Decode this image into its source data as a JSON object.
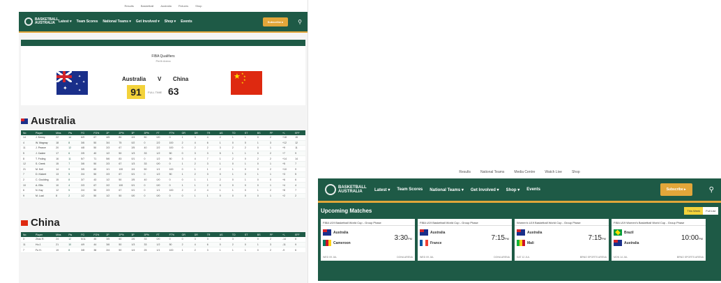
{
  "left": {
    "top_links": [
      "Results",
      "Basketball",
      "Australia",
      "Fixtures",
      "Shop"
    ],
    "nav": {
      "logo_text": "BASKETBALL AUSTRALIA",
      "items": [
        "Latest ▾",
        "Team Scores",
        "National Teams ▾",
        "Get Involved ▾",
        "Shop ▾",
        "Events"
      ],
      "button": "Subscribe ▸"
    },
    "match": {
      "venue": "FIBA Qualifiers",
      "venue_sub": "Perth Arena",
      "home_team": "Australia",
      "vs": "V",
      "away_team": "China",
      "home_score": "91",
      "status": "FULL TIME",
      "away_score": "63"
    },
    "australia_title": "Australia",
    "china_title": "China",
    "table_headers": [
      "No",
      "Player",
      "Mins",
      "Pts",
      "FG",
      "FG%",
      "2P",
      "2P%",
      "3P",
      "3P%",
      "FT",
      "FT%",
      "OR",
      "DR",
      "TR",
      "AS",
      "TO",
      "ST",
      "BS",
      "PF",
      "+/-",
      "EFF"
    ],
    "australia_rows": [
      [
        "14",
        "J. Kenny",
        "22",
        "14",
        "6/9",
        "67",
        "4/5",
        "80",
        "2/4",
        "50",
        "0/0",
        "0",
        "1",
        "3",
        "4",
        "2",
        "1",
        "1",
        "0",
        "2",
        "+18",
        "15"
      ],
      [
        "4",
        "W. Magnay",
        "18",
        "8",
        "3/6",
        "50",
        "3/4",
        "75",
        "0/2",
        "0",
        "2/2",
        "100",
        "2",
        "4",
        "6",
        "1",
        "0",
        "0",
        "1",
        "3",
        "+12",
        "12"
      ],
      [
        "11",
        "J. Pearce",
        "20",
        "12",
        "4/8",
        "50",
        "2/3",
        "67",
        "2/5",
        "40",
        "2/2",
        "100",
        "0",
        "2",
        "2",
        "3",
        "2",
        "2",
        "0",
        "1",
        "+9",
        "11"
      ],
      [
        "5",
        "J. Cadee",
        "17",
        "6",
        "2/5",
        "40",
        "1/2",
        "50",
        "1/3",
        "33",
        "1/2",
        "50",
        "0",
        "3",
        "3",
        "5",
        "1",
        "1",
        "0",
        "2",
        "+7",
        "9"
      ],
      [
        "8",
        "T. Froling",
        "16",
        "11",
        "5/7",
        "71",
        "5/6",
        "83",
        "0/1",
        "0",
        "1/2",
        "50",
        "3",
        "4",
        "7",
        "1",
        "2",
        "0",
        "2",
        "2",
        "+14",
        "14"
      ],
      [
        "12",
        "S. Creek",
        "15",
        "7",
        "3/6",
        "50",
        "2/3",
        "67",
        "1/3",
        "33",
        "0/0",
        "0",
        "1",
        "2",
        "3",
        "1",
        "0",
        "1",
        "0",
        "1",
        "+5",
        "7"
      ],
      [
        "21",
        "M. Kell",
        "14",
        "9",
        "3/5",
        "60",
        "1/1",
        "100",
        "2/4",
        "50",
        "1/1",
        "100",
        "0",
        "1",
        "1",
        "2",
        "1",
        "0",
        "0",
        "2",
        "+10",
        "9"
      ],
      [
        "7",
        "D. Kickert",
        "13",
        "5",
        "2/4",
        "50",
        "2/3",
        "67",
        "0/1",
        "0",
        "1/2",
        "50",
        "1",
        "2",
        "3",
        "0",
        "1",
        "0",
        "1",
        "1",
        "+3",
        "5"
      ],
      [
        "2",
        "C. Goulding",
        "15",
        "8",
        "3/7",
        "43",
        "1/2",
        "50",
        "2/5",
        "40",
        "0/0",
        "0",
        "0",
        "1",
        "1",
        "2",
        "0",
        "1",
        "0",
        "0",
        "+6",
        "6"
      ],
      [
        "10",
        "A. Ellis",
        "10",
        "4",
        "2/3",
        "67",
        "2/2",
        "100",
        "0/1",
        "0",
        "0/0",
        "0",
        "1",
        "1",
        "2",
        "0",
        "0",
        "0",
        "0",
        "1",
        "+4",
        "4"
      ],
      [
        "6",
        "N. Kay",
        "12",
        "5",
        "2/4",
        "50",
        "2/3",
        "67",
        "0/1",
        "0",
        "1/1",
        "100",
        "2",
        "2",
        "4",
        "1",
        "1",
        "0",
        "1",
        "2",
        "+8",
        "7"
      ],
      [
        "9",
        "M. Lual",
        "8",
        "2",
        "1/2",
        "50",
        "1/2",
        "50",
        "0/0",
        "0",
        "0/0",
        "0",
        "0",
        "1",
        "1",
        "0",
        "0",
        "0",
        "0",
        "1",
        "+2",
        "2"
      ]
    ],
    "china_rows": [
      [
        "3",
        "Zhao R.",
        "24",
        "12",
        "5/11",
        "45",
        "3/5",
        "60",
        "2/6",
        "33",
        "0/0",
        "0",
        "0",
        "3",
        "3",
        "4",
        "3",
        "1",
        "0",
        "2",
        "-14",
        "8"
      ],
      [
        "11",
        "Hu J.",
        "21",
        "10",
        "4/9",
        "44",
        "3/6",
        "50",
        "1/3",
        "33",
        "1/2",
        "50",
        "2",
        "4",
        "6",
        "0",
        "2",
        "0",
        "1",
        "3",
        "-11",
        "9"
      ],
      [
        "7",
        "Fu H.",
        "19",
        "8",
        "3/8",
        "38",
        "2/4",
        "50",
        "1/4",
        "25",
        "1/1",
        "100",
        "1",
        "2",
        "3",
        "1",
        "1",
        "1",
        "0",
        "2",
        "-9",
        "6"
      ]
    ]
  },
  "right": {
    "top_links": [
      "Results",
      "National Teams",
      "Media Centre",
      "Watch Live",
      "Shop"
    ],
    "nav": {
      "logo_text": "BASKETBALL AUSTRALIA",
      "items": [
        "Latest ▾",
        "Team Scores",
        "National Teams ▾",
        "Get Involved ▾",
        "Shop ▾",
        "Events"
      ],
      "button": "Subscribe ▸"
    },
    "section_title": "Upcoming Matches",
    "toggle": [
      "This Week",
      "Full List"
    ],
    "cards": [
      {
        "title": "FIBA U19 Basketball World Cup - Group Phase",
        "team1": "Australia",
        "team2": "Cameroon",
        "time": "3:30",
        "ampm": "PM",
        "foot_left": "WED 09 JUL",
        "foot_right": "DOHA ARENA"
      },
      {
        "title": "FIBA U19 Basketball World Cup - Group Phase",
        "team1": "Australia",
        "team2": "France",
        "time": "7:15",
        "ampm": "PM",
        "foot_left": "WED 09 JUL",
        "foot_right": "DOHA ARENA"
      },
      {
        "title": "Women's U19 Basketball World Cup - Group Phase",
        "team1": "Australia",
        "team2": "Mali",
        "time": "7:15",
        "ampm": "PM",
        "foot_left": "SAT 12 JUL",
        "foot_right": "BRNO SPORTS ARENA"
      },
      {
        "title": "FIBA U19 Women's Basketball World Cup - Group Phase",
        "team1": "Brazil",
        "team2": "Australia",
        "time": "10:00",
        "ampm": "PM",
        "foot_left": "MON 14 JUL",
        "foot_right": "BRNO SPORTS ARENA"
      }
    ]
  }
}
